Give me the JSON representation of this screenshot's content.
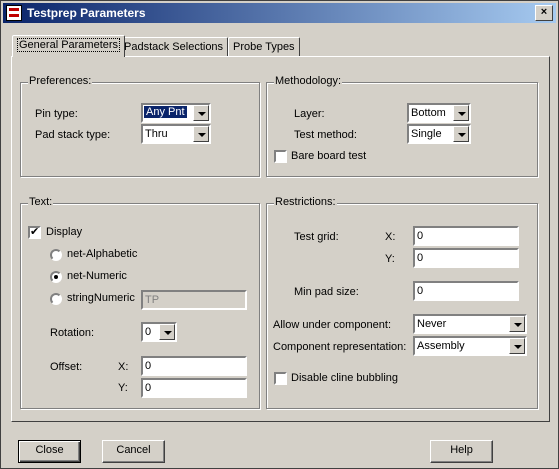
{
  "window": {
    "title": "Testprep Parameters",
    "close_glyph": "×"
  },
  "tabs": [
    {
      "label": "General Parameters"
    },
    {
      "label": "Padstack Selections"
    },
    {
      "label": "Probe Types"
    }
  ],
  "preferences": {
    "legend": "Preferences:",
    "pin_type_label": "Pin type:",
    "pin_type_value": "Any Pnt",
    "pad_stack_label": "Pad stack type:",
    "pad_stack_value": "Thru"
  },
  "methodology": {
    "legend": "Methodology:",
    "layer_label": "Layer:",
    "layer_value": "Bottom",
    "test_method_label": "Test method:",
    "test_method_value": "Single",
    "bare_board_label": "Bare board test",
    "bare_board_checked": false
  },
  "text": {
    "legend": "Text:",
    "display_label": "Display",
    "display_checked": true,
    "radio_alpha": "net-Alphabetic",
    "radio_numeric": "net-Numeric",
    "radio_string": "stringNumeric",
    "selected_radio": "net-Numeric",
    "string_value": "TP",
    "rotation_label": "Rotation:",
    "rotation_value": "0",
    "offset_label": "Offset:",
    "x_label": "X:",
    "x_value": "0",
    "y_label": "Y:",
    "y_value": "0"
  },
  "restrictions": {
    "legend": "Restrictions:",
    "test_grid_label": "Test grid:",
    "x_label": "X:",
    "x_value": "0",
    "y_label": "Y:",
    "y_value": "0",
    "min_pad_label": "Min pad size:",
    "min_pad_value": "0",
    "allow_under_label": "Allow under component:",
    "allow_under_value": "Never",
    "comp_rep_label": "Component representation:",
    "comp_rep_value": "Assembly",
    "disable_cline_label": "Disable cline bubbling",
    "disable_cline_checked": false
  },
  "buttons": {
    "close": "Close",
    "cancel": "Cancel",
    "help": "Help"
  },
  "colors": {
    "face": "#d4d0c8",
    "title_start": "#0a246a",
    "title_end": "#a6caf0",
    "selection": "#0a246a"
  }
}
